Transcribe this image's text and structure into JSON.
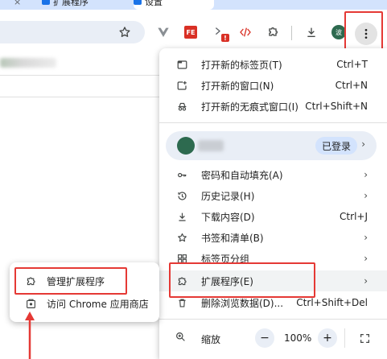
{
  "tabs": [
    {
      "label": "×"
    },
    {
      "label": "扩展程序"
    },
    {
      "label": "设置"
    }
  ],
  "toolbar": {
    "ext_fe_label": "FE",
    "ext_badge": "!",
    "profile_letter": "波"
  },
  "menu": {
    "items_top": [
      {
        "label": "打开新的标签页(T)",
        "shortcut": "Ctrl+T",
        "icon": "new-tab-icon"
      },
      {
        "label": "打开新的窗口(N)",
        "shortcut": "Ctrl+N",
        "icon": "new-window-icon"
      },
      {
        "label": "打开新的无痕式窗口(I)",
        "shortcut": "Ctrl+Shift+N",
        "icon": "incognito-icon"
      }
    ],
    "profile_status": "已登录",
    "items_mid": [
      {
        "label": "密码和自动填充(A)",
        "icon": "key-icon"
      },
      {
        "label": "历史记录(H)",
        "icon": "history-icon"
      },
      {
        "label": "下载内容(D)",
        "shortcut": "Ctrl+J",
        "icon": "download-icon"
      },
      {
        "label": "书签和清单(B)",
        "icon": "star-icon"
      },
      {
        "label": "标签页分组",
        "icon": "tab-groups-icon"
      },
      {
        "label": "扩展程序(E)",
        "icon": "extensions-icon"
      },
      {
        "label": "删除浏览数据(D)...",
        "shortcut": "Ctrl+Shift+Del",
        "icon": "trash-icon"
      }
    ],
    "zoom_label": "缩放",
    "zoom_minus": "−",
    "zoom_value": "100%",
    "zoom_plus": "+"
  },
  "submenu": {
    "items": [
      {
        "label": "管理扩展程序",
        "icon": "extensions-icon"
      },
      {
        "label": "访问 Chrome 应用商店",
        "icon": "web-store-icon"
      }
    ]
  },
  "colors": {
    "annotation_red": "#e53935",
    "menu_bg": "#ffffff",
    "profile_bg": "#e9eef6",
    "status_pill": "#d3e3fd"
  }
}
